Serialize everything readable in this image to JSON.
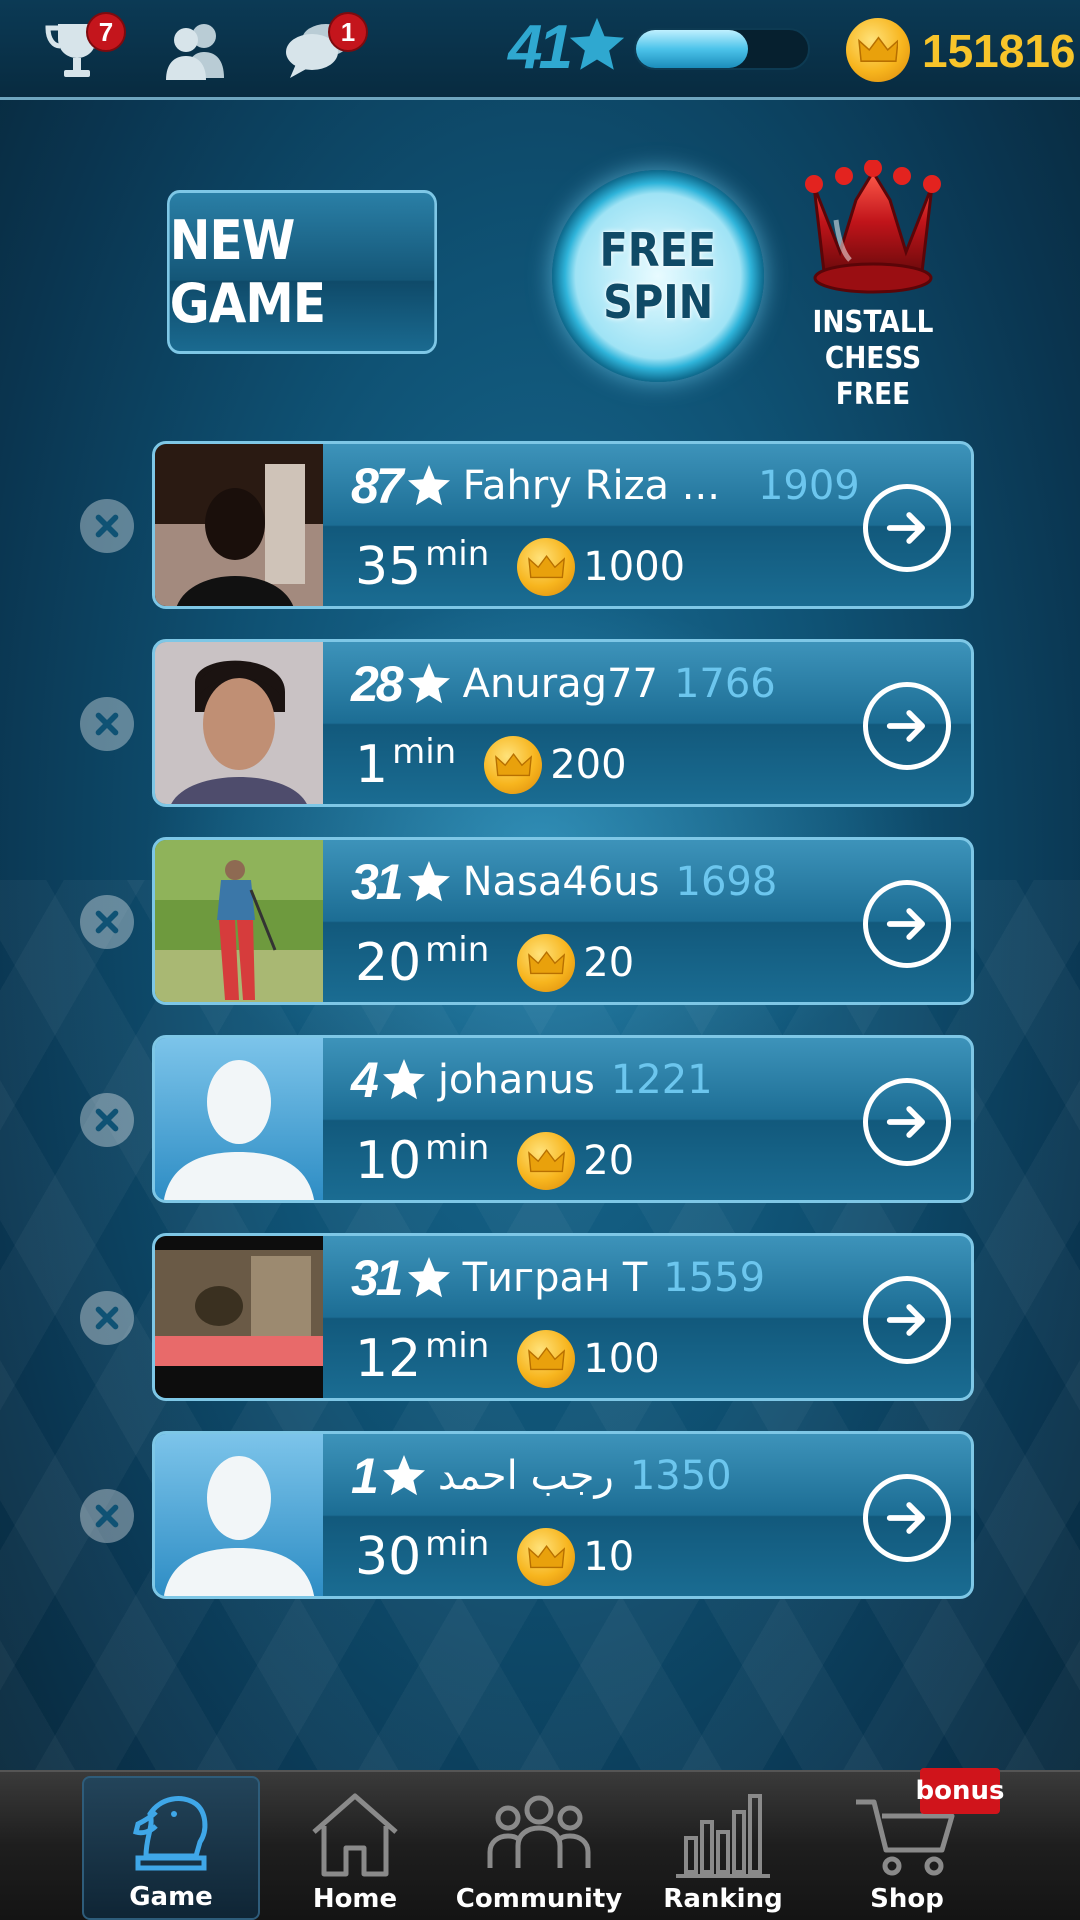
{
  "topbar": {
    "achievements_badge": "7",
    "messages_badge": "1",
    "level": "41",
    "xp_fraction": 0.65,
    "coins": "151816"
  },
  "actions": {
    "new_game_label": "NEW GAME",
    "free_spin_line1": "FREE",
    "free_spin_line2": "SPIN",
    "install_line1": "INSTALL",
    "install_line2": "CHESS FREE"
  },
  "games": [
    {
      "stars": "87",
      "name": "Fahry Riza ...",
      "rating": "1909",
      "time": "35",
      "unit": "min",
      "bet": "1000",
      "avatar": "photo-dark"
    },
    {
      "stars": "28",
      "name": "Anurag77",
      "rating": "1766",
      "time": "1",
      "unit": "min",
      "bet": "200",
      "avatar": "photo-portrait"
    },
    {
      "stars": "31",
      "name": "Nasa46us",
      "rating": "1698",
      "time": "20",
      "unit": "min",
      "bet": "20",
      "avatar": "photo-golf"
    },
    {
      "stars": "4",
      "name": "johanus",
      "rating": "1221",
      "time": "10",
      "unit": "min",
      "bet": "20",
      "avatar": "silhouette"
    },
    {
      "stars": "31",
      "name": "Тигран Т",
      "rating": "1559",
      "time": "12",
      "unit": "min",
      "bet": "100",
      "avatar": "photo-street"
    },
    {
      "stars": "1",
      "name": "رجب احمد",
      "rating": "1350",
      "time": "30",
      "unit": "min",
      "bet": "10",
      "avatar": "silhouette"
    }
  ],
  "nav": {
    "game": "Game",
    "home": "Home",
    "community": "Community",
    "ranking": "Ranking",
    "shop": "Shop",
    "bonus": "bonus"
  },
  "colors": {
    "accent": "#2fa8d0",
    "coin_text": "#f8c42a",
    "rating": "#6cc6ee",
    "badge": "#c4151c"
  }
}
